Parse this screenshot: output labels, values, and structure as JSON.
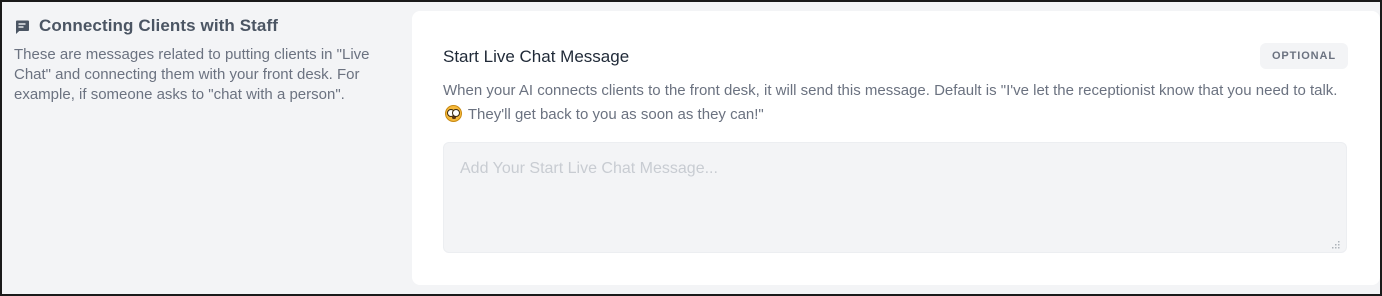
{
  "section": {
    "icon": "chat-icon",
    "title": "Connecting Clients with Staff",
    "description": "These are messages related to putting clients in \"Live Chat\" and connecting them with your front desk. For example, if someone asks to \"chat with a person\"."
  },
  "field": {
    "title": "Start Live Chat Message",
    "badge": "OPTIONAL",
    "description_part1": "When your AI connects clients to the front desk, it will send this message. Default is \"I've let the receptionist know that you need to talk. ",
    "emoji_icon": "face-with-open-mouth-icon",
    "description_part2": " They'll get back to you as soon as they can!\"",
    "value": "",
    "placeholder": "Add Your Start Live Chat Message..."
  },
  "colors": {
    "page_background": "#f3f4f6",
    "card_background": "#ffffff",
    "title_text": "#4b5563",
    "muted_text": "#6b7280",
    "placeholder_text": "#c8ccd2"
  }
}
